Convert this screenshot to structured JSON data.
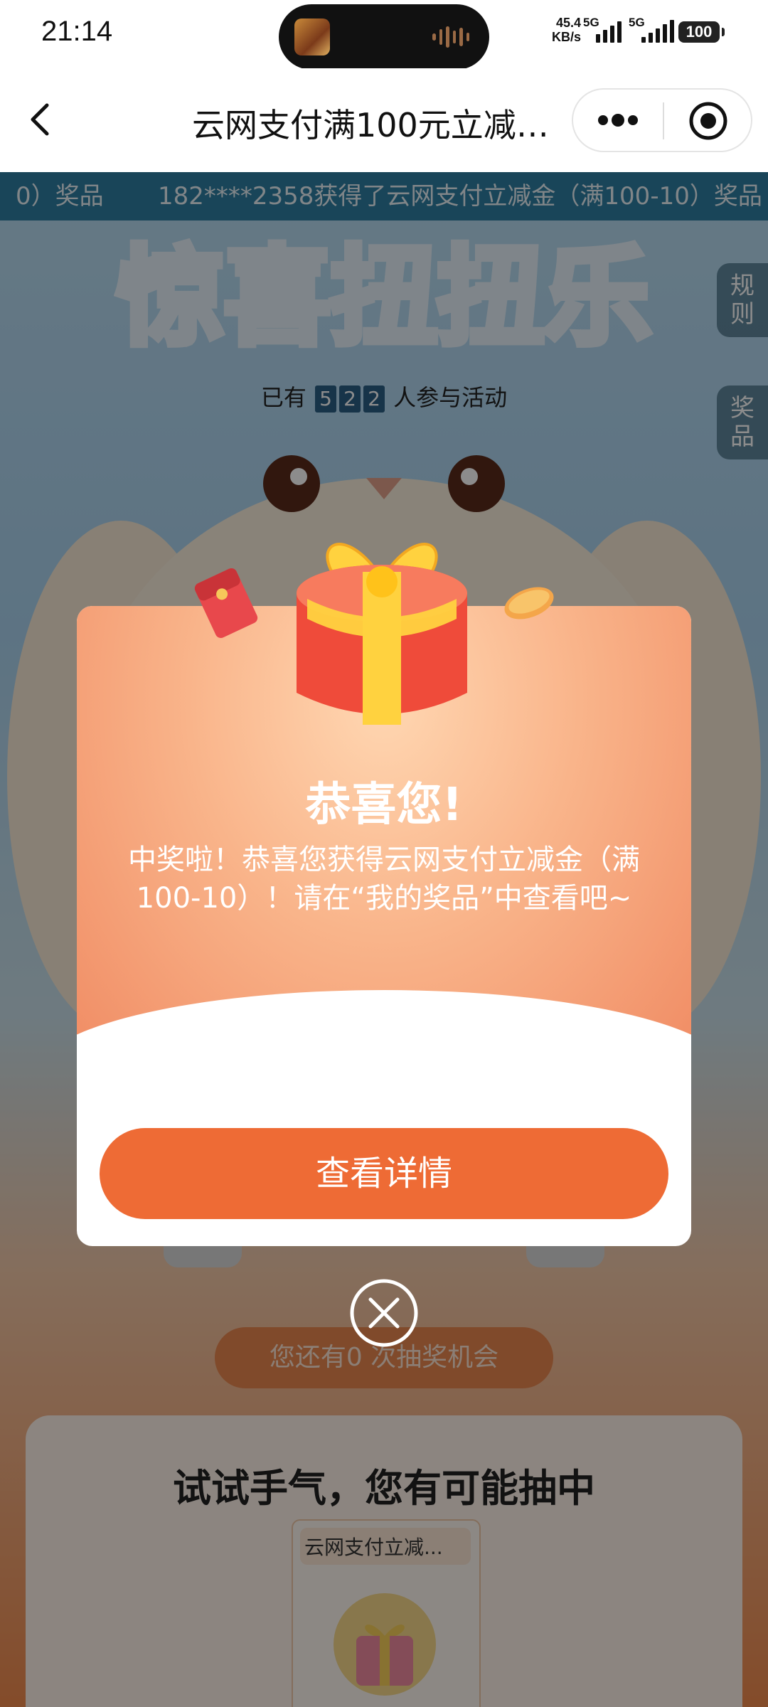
{
  "status_bar": {
    "time": "21:14",
    "net_speed_value": "45.4",
    "net_speed_unit": "KB/s",
    "sim1_label": "5G",
    "sim2_label": "5G",
    "battery": "100"
  },
  "nav": {
    "title": "云网支付满100元立减1...",
    "back_icon": "chevron-left-icon",
    "more_icon": "more-dots-icon",
    "close_icon": "target-close-icon"
  },
  "ticker": {
    "fragment": "0）奖品",
    "message": "182****2358获得了云网支付立减金（满100-10）奖品"
  },
  "hero": {
    "title": "惊喜扭扭乐",
    "participants_prefix": "已有",
    "participant_digits": [
      "5",
      "2",
      "2"
    ],
    "participants_suffix": "人参与活动"
  },
  "side_tabs": {
    "rules": "规则",
    "prizes": "奖品"
  },
  "chance": {
    "text": "您还有0 次抽奖机会"
  },
  "try_luck": {
    "title": "试试手气，您有可能抽中",
    "prize_label": "云网支付立减..."
  },
  "modal": {
    "heading": "恭喜您!",
    "message": "中奖啦！恭喜您获得云网支付立减金（满100-10）！请在“我的奖品”中查看吧~",
    "button": "查看详情",
    "close_icon": "close-circle-icon"
  },
  "colors": {
    "accent": "#ee6b35",
    "ticker_bg": "#2e7fa3",
    "digit_bg": "#2b5f86"
  }
}
